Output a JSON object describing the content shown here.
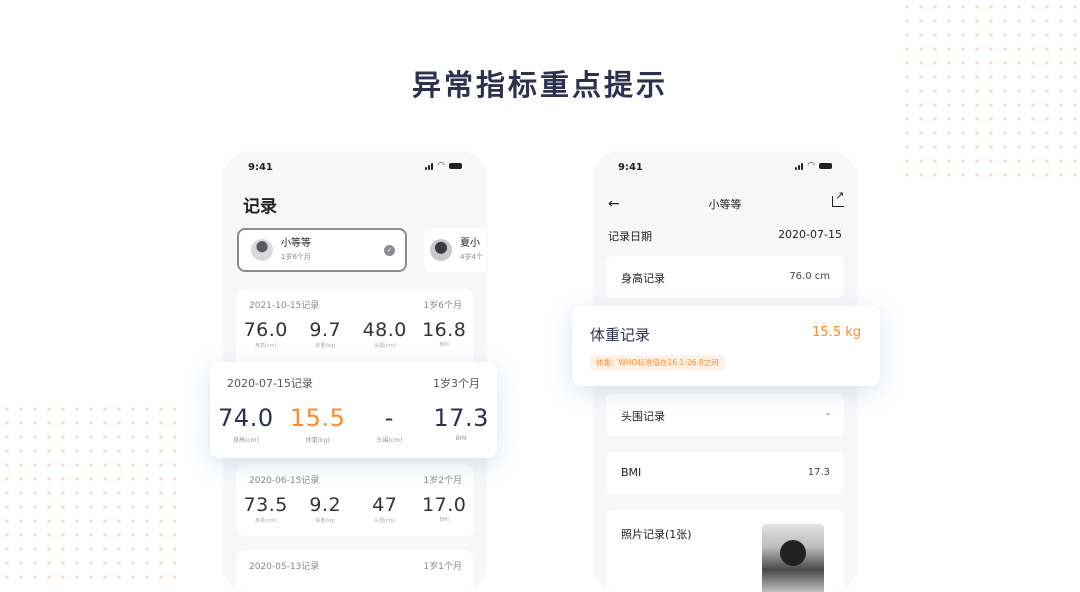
{
  "title": "异常指标重点提示",
  "colors": {
    "accent": "#ff8a2a",
    "navy": "#2c3150",
    "dots": "#f7d6bf"
  },
  "left_phone": {
    "status_time": "9:41",
    "header_title": "记录",
    "profiles": [
      {
        "name": "小等等",
        "info": "1岁6个月",
        "selected": true
      },
      {
        "name": "夏小",
        "info": "4岁4个",
        "selected": false
      }
    ],
    "records": [
      {
        "date": "2021-10-15记录",
        "age": "1岁6个月",
        "metrics": [
          {
            "value": "76.0",
            "label": "身高(cm)"
          },
          {
            "value": "9.7",
            "label": "体重(kg)"
          },
          {
            "value": "48.0",
            "label": "头围(cm)"
          },
          {
            "value": "16.8",
            "label": "BMI"
          }
        ]
      },
      {
        "date": "2020-06-15记录",
        "age": "1岁2个月",
        "metrics": [
          {
            "value": "73.5",
            "label": "身高(cm)"
          },
          {
            "value": "9.2",
            "label": "体重(kg)"
          },
          {
            "value": "47",
            "label": "头围(cm)"
          },
          {
            "value": "17.0",
            "label": "BMI"
          }
        ]
      },
      {
        "date": "2020-05-13记录",
        "age": "1岁1个月"
      }
    ],
    "highlight_record": {
      "date": "2020-07-15记录",
      "age": "1岁3个月",
      "metrics": [
        {
          "value": "74.0",
          "label": "身高(cm)"
        },
        {
          "value": "15.5",
          "label": "体重(kg)",
          "abnormal": true
        },
        {
          "value": "-",
          "label": "头围(cm)"
        },
        {
          "value": "17.3",
          "label": "BMI"
        }
      ]
    }
  },
  "right_phone": {
    "status_time": "9:41",
    "nav_title": "小等等",
    "record_date_label": "记录日期",
    "record_date_value": "2020-07-15",
    "rows": [
      {
        "label": "身高记录",
        "value": "76.0 cm"
      },
      {
        "label": "头围记录",
        "value": "-"
      },
      {
        "label": "BMI",
        "value": "17.3"
      },
      {
        "label": "照片记录(1张)",
        "value": ""
      }
    ],
    "weight_popup": {
      "label": "体重记录",
      "value": "15.5 kg",
      "tip": "体重：WHO标准值在16.1-26.8之间"
    }
  }
}
